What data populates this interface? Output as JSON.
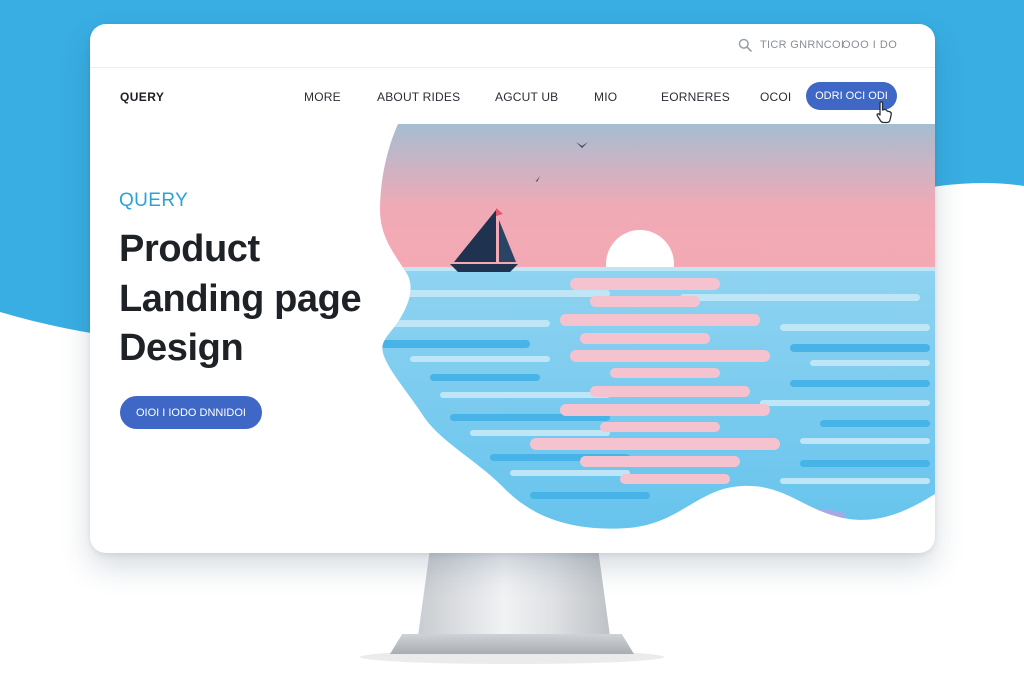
{
  "colors": {
    "backdrop_blue": "#39aee3",
    "accent_blue": "#3f67c6",
    "eyebrow_cyan": "#2ba3d6",
    "heading_dark": "#1e2126",
    "sky_top": "#a6bdd1",
    "sky_bottom": "#f2a8b4",
    "sea": "#6ec8ee",
    "sun": "#ffffff",
    "boat": "#1f3350"
  },
  "topbar": {
    "search_icon": "search-icon",
    "text": "TICR GNRNCOI",
    "count": "OOO I DO"
  },
  "nav": {
    "brand": "QUERY",
    "items": [
      "MORE",
      "ABOUT RIDES",
      "AGCUT UB",
      "MIO",
      "EORNERES",
      "OCOI"
    ],
    "cta": "ODRI OCI ODI",
    "cursor_icon": "hand-pointer-icon"
  },
  "hero": {
    "eyebrow": "QUERY",
    "title_lines": [
      "Product",
      "Landing page",
      "Design"
    ],
    "cta": "OIOI I IODO DNNIDOI",
    "illustration": "sunset-sea-sailboat-illustration"
  }
}
